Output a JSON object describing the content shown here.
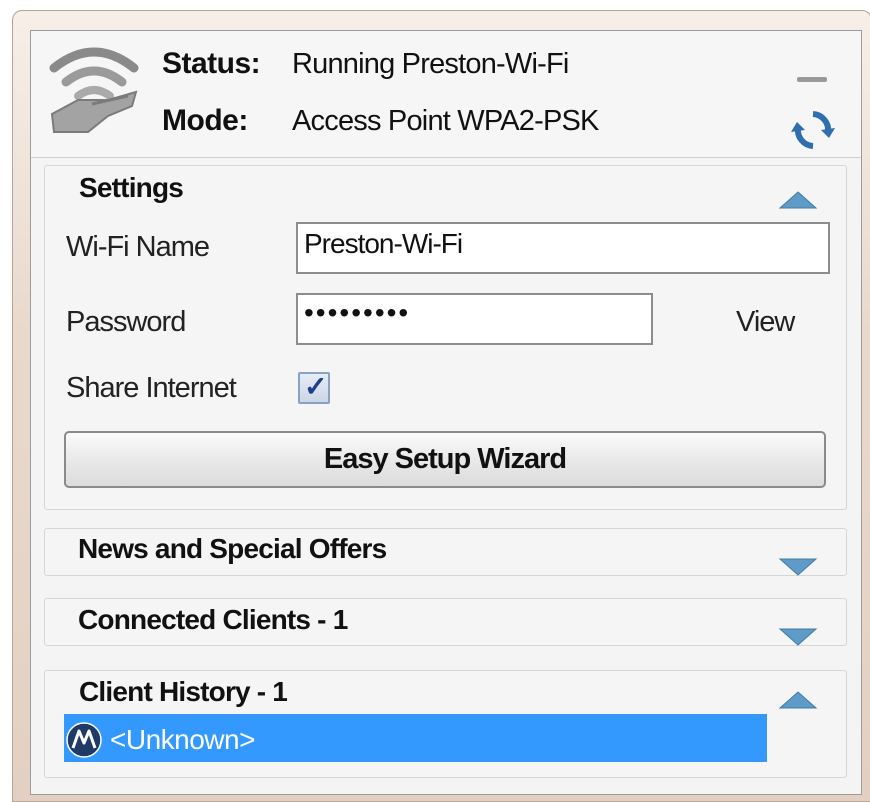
{
  "header": {
    "status_label": "Status:",
    "status_value": "Running Preston-Wi-Fi",
    "mode_label": "Mode:",
    "mode_value": "Access Point WPA2-PSK"
  },
  "settings": {
    "title": "Settings",
    "wifi_name_label": "Wi-Fi Name",
    "wifi_name_value": "Preston-Wi-Fi",
    "password_label": "Password",
    "password_masked": "•••••••••",
    "view_label": "View",
    "share_internet_label": "Share Internet",
    "share_internet_checked": true,
    "wizard_button": "Easy Setup Wizard",
    "expanded": true
  },
  "news": {
    "title": "News and Special Offers",
    "expanded": false
  },
  "connected_clients": {
    "title": "Connected Clients - 1",
    "expanded": false
  },
  "client_history": {
    "title": "Client History - 1",
    "expanded": true,
    "items": [
      {
        "name": "<Unknown>",
        "icon": "motorola-icon"
      }
    ]
  },
  "colors": {
    "selection": "#3399ff",
    "frame": "#e9d9cd",
    "chevron": "#5e9cc7"
  }
}
